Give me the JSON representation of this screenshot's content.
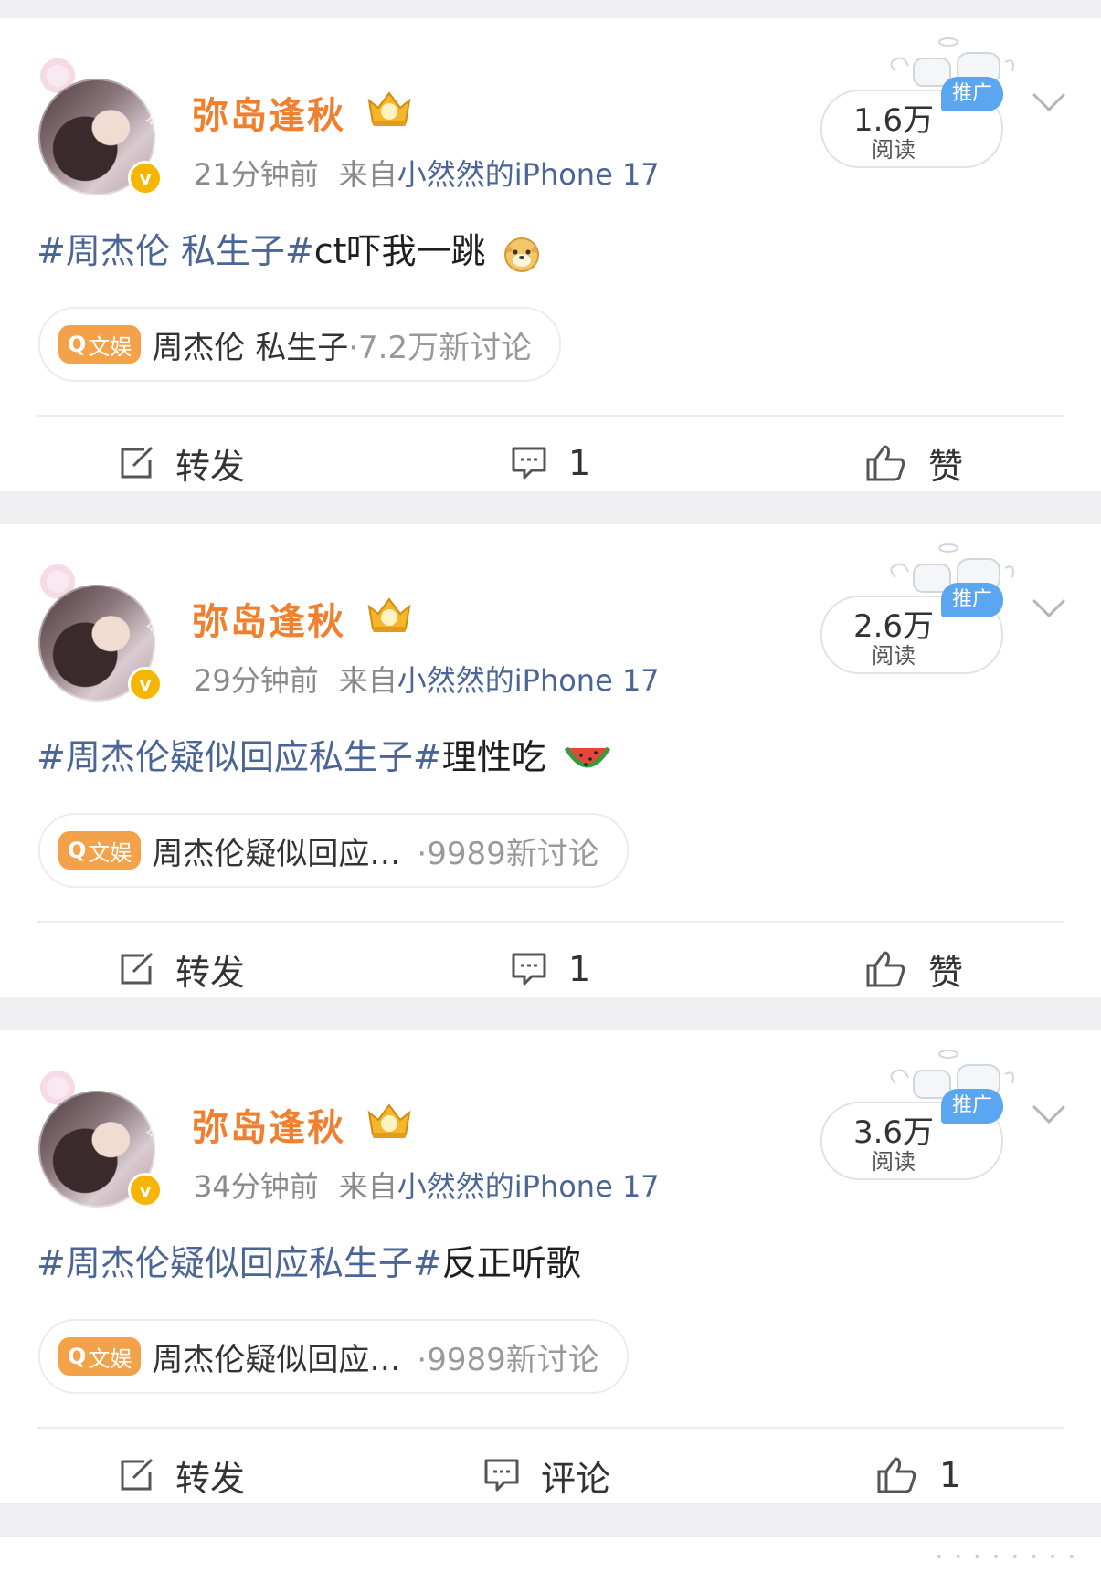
{
  "posts": [
    {
      "username": "弥岛逢秋",
      "time": "21分钟前",
      "source_prefix": "来自",
      "device": "小然然的iPhone 17",
      "reads_value": "1.6万",
      "reads_label": "阅读",
      "promo_label": "推广",
      "text_hashtag": "#周杰伦 私生子#",
      "text_body": "ct吓我一跳",
      "emoji": "doge-emoji",
      "topic_category": "文娱",
      "topic_name": "周杰伦 私生子",
      "topic_count": "·7.2万新讨论",
      "repost_label": "转发",
      "comment_label": "1",
      "like_label": "赞"
    },
    {
      "username": "弥岛逢秋",
      "time": "29分钟前",
      "source_prefix": "来自",
      "device": "小然然的iPhone 17",
      "reads_value": "2.6万",
      "reads_label": "阅读",
      "promo_label": "推广",
      "text_hashtag": "#周杰伦疑似回应私生子#",
      "text_body": "理性吃",
      "emoji": "watermelon-emoji",
      "topic_category": "文娱",
      "topic_name": "周杰伦疑似回应…",
      "topic_count": "·9989新讨论",
      "repost_label": "转发",
      "comment_label": "1",
      "like_label": "赞"
    },
    {
      "username": "弥岛逢秋",
      "time": "34分钟前",
      "source_prefix": "来自",
      "device": "小然然的iPhone 17",
      "reads_value": "3.6万",
      "reads_label": "阅读",
      "promo_label": "推广",
      "text_hashtag": "#周杰伦疑似回应私生子#",
      "text_body": "反正听歌",
      "emoji": "",
      "topic_category": "文娱",
      "topic_name": "周杰伦疑似回应…",
      "topic_count": "·9989新讨论",
      "repost_label": "转发",
      "comment_label": "评论",
      "like_label": "1"
    }
  ],
  "colors": {
    "username": "#f07f2e",
    "hashtag": "#4a6596",
    "verified_badge": "#f7b500",
    "topic_tag": "#f4a24a",
    "promo_badge": "#5aa6f0"
  }
}
